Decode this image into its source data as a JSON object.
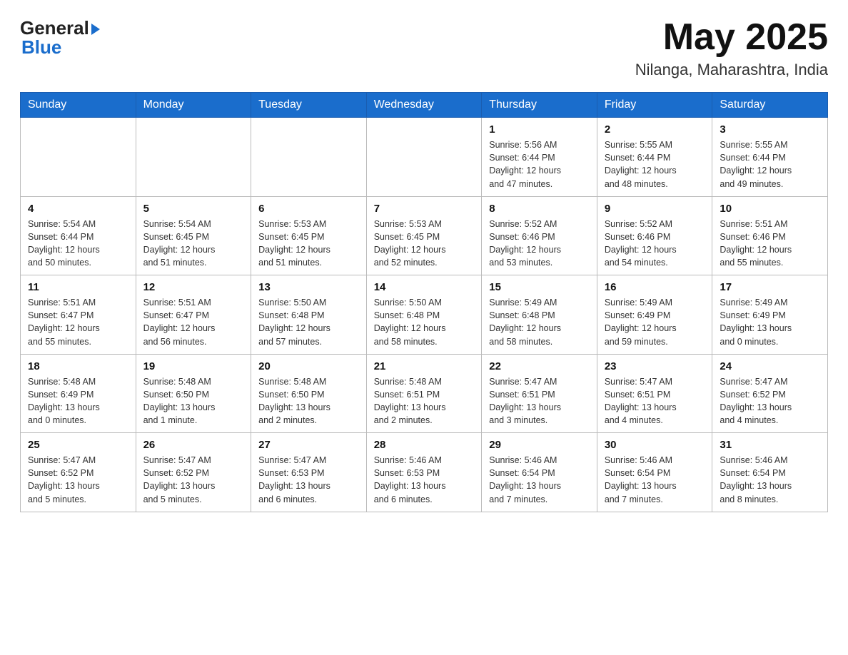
{
  "header": {
    "logo_general": "General",
    "logo_blue": "Blue",
    "month_title": "May 2025",
    "location": "Nilanga, Maharashtra, India"
  },
  "days_of_week": [
    "Sunday",
    "Monday",
    "Tuesday",
    "Wednesday",
    "Thursday",
    "Friday",
    "Saturday"
  ],
  "weeks": [
    [
      {
        "day": "",
        "info": ""
      },
      {
        "day": "",
        "info": ""
      },
      {
        "day": "",
        "info": ""
      },
      {
        "day": "",
        "info": ""
      },
      {
        "day": "1",
        "info": "Sunrise: 5:56 AM\nSunset: 6:44 PM\nDaylight: 12 hours\nand 47 minutes."
      },
      {
        "day": "2",
        "info": "Sunrise: 5:55 AM\nSunset: 6:44 PM\nDaylight: 12 hours\nand 48 minutes."
      },
      {
        "day": "3",
        "info": "Sunrise: 5:55 AM\nSunset: 6:44 PM\nDaylight: 12 hours\nand 49 minutes."
      }
    ],
    [
      {
        "day": "4",
        "info": "Sunrise: 5:54 AM\nSunset: 6:44 PM\nDaylight: 12 hours\nand 50 minutes."
      },
      {
        "day": "5",
        "info": "Sunrise: 5:54 AM\nSunset: 6:45 PM\nDaylight: 12 hours\nand 51 minutes."
      },
      {
        "day": "6",
        "info": "Sunrise: 5:53 AM\nSunset: 6:45 PM\nDaylight: 12 hours\nand 51 minutes."
      },
      {
        "day": "7",
        "info": "Sunrise: 5:53 AM\nSunset: 6:45 PM\nDaylight: 12 hours\nand 52 minutes."
      },
      {
        "day": "8",
        "info": "Sunrise: 5:52 AM\nSunset: 6:46 PM\nDaylight: 12 hours\nand 53 minutes."
      },
      {
        "day": "9",
        "info": "Sunrise: 5:52 AM\nSunset: 6:46 PM\nDaylight: 12 hours\nand 54 minutes."
      },
      {
        "day": "10",
        "info": "Sunrise: 5:51 AM\nSunset: 6:46 PM\nDaylight: 12 hours\nand 55 minutes."
      }
    ],
    [
      {
        "day": "11",
        "info": "Sunrise: 5:51 AM\nSunset: 6:47 PM\nDaylight: 12 hours\nand 55 minutes."
      },
      {
        "day": "12",
        "info": "Sunrise: 5:51 AM\nSunset: 6:47 PM\nDaylight: 12 hours\nand 56 minutes."
      },
      {
        "day": "13",
        "info": "Sunrise: 5:50 AM\nSunset: 6:48 PM\nDaylight: 12 hours\nand 57 minutes."
      },
      {
        "day": "14",
        "info": "Sunrise: 5:50 AM\nSunset: 6:48 PM\nDaylight: 12 hours\nand 58 minutes."
      },
      {
        "day": "15",
        "info": "Sunrise: 5:49 AM\nSunset: 6:48 PM\nDaylight: 12 hours\nand 58 minutes."
      },
      {
        "day": "16",
        "info": "Sunrise: 5:49 AM\nSunset: 6:49 PM\nDaylight: 12 hours\nand 59 minutes."
      },
      {
        "day": "17",
        "info": "Sunrise: 5:49 AM\nSunset: 6:49 PM\nDaylight: 13 hours\nand 0 minutes."
      }
    ],
    [
      {
        "day": "18",
        "info": "Sunrise: 5:48 AM\nSunset: 6:49 PM\nDaylight: 13 hours\nand 0 minutes."
      },
      {
        "day": "19",
        "info": "Sunrise: 5:48 AM\nSunset: 6:50 PM\nDaylight: 13 hours\nand 1 minute."
      },
      {
        "day": "20",
        "info": "Sunrise: 5:48 AM\nSunset: 6:50 PM\nDaylight: 13 hours\nand 2 minutes."
      },
      {
        "day": "21",
        "info": "Sunrise: 5:48 AM\nSunset: 6:51 PM\nDaylight: 13 hours\nand 2 minutes."
      },
      {
        "day": "22",
        "info": "Sunrise: 5:47 AM\nSunset: 6:51 PM\nDaylight: 13 hours\nand 3 minutes."
      },
      {
        "day": "23",
        "info": "Sunrise: 5:47 AM\nSunset: 6:51 PM\nDaylight: 13 hours\nand 4 minutes."
      },
      {
        "day": "24",
        "info": "Sunrise: 5:47 AM\nSunset: 6:52 PM\nDaylight: 13 hours\nand 4 minutes."
      }
    ],
    [
      {
        "day": "25",
        "info": "Sunrise: 5:47 AM\nSunset: 6:52 PM\nDaylight: 13 hours\nand 5 minutes."
      },
      {
        "day": "26",
        "info": "Sunrise: 5:47 AM\nSunset: 6:52 PM\nDaylight: 13 hours\nand 5 minutes."
      },
      {
        "day": "27",
        "info": "Sunrise: 5:47 AM\nSunset: 6:53 PM\nDaylight: 13 hours\nand 6 minutes."
      },
      {
        "day": "28",
        "info": "Sunrise: 5:46 AM\nSunset: 6:53 PM\nDaylight: 13 hours\nand 6 minutes."
      },
      {
        "day": "29",
        "info": "Sunrise: 5:46 AM\nSunset: 6:54 PM\nDaylight: 13 hours\nand 7 minutes."
      },
      {
        "day": "30",
        "info": "Sunrise: 5:46 AM\nSunset: 6:54 PM\nDaylight: 13 hours\nand 7 minutes."
      },
      {
        "day": "31",
        "info": "Sunrise: 5:46 AM\nSunset: 6:54 PM\nDaylight: 13 hours\nand 8 minutes."
      }
    ]
  ]
}
